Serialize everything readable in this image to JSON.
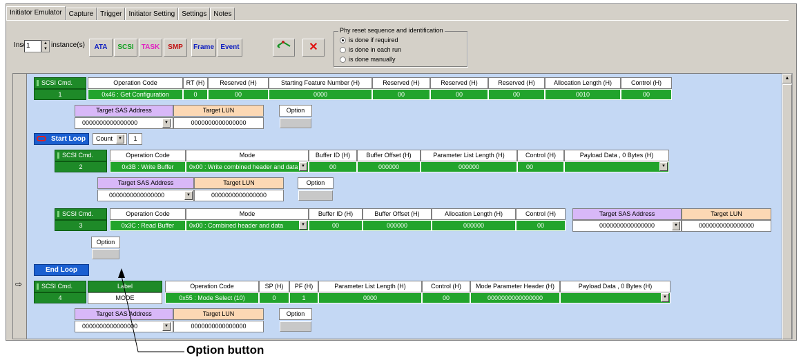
{
  "tabs": [
    "Initiator Emulator",
    "Capture",
    "Trigger",
    "Initiator Setting",
    "Settings",
    "Notes"
  ],
  "toolbar": {
    "insert_label": "Insert",
    "insert_value": "1",
    "instance_label": "instance(s)",
    "buttons": [
      "ATA",
      "SCSI",
      "TASK",
      "SMP",
      "Frame",
      "Event"
    ],
    "delete_glyph": "✕"
  },
  "phy": {
    "title": "Phy reset sequence and identification",
    "options": [
      "is done if required",
      "is done in each run",
      "is done manually"
    ],
    "selected": 0
  },
  "common": {
    "scsi_cmd": "SCSI Cmd.",
    "target_sas": "Target SAS Address",
    "target_lun": "Target LUN",
    "option": "Option",
    "sas_value": "0000000000000000",
    "lun_value": "0000000000000000",
    "opcode": "Operation Code",
    "control": "Control (H)"
  },
  "cmd1": {
    "num": "1",
    "headers": [
      "RT (H)",
      "Reserved (H)",
      "Starting Feature Number (H)",
      "Reserved (H)",
      "Reserved (H)",
      "Reserved (H)",
      "Allocation Length (H)"
    ],
    "opcode_value": "0x46 : Get Configuration",
    "values": [
      "0",
      "00",
      "0000",
      "00",
      "00",
      "00",
      "0010",
      "00"
    ]
  },
  "loop": {
    "start": "Start Loop",
    "count_label": "Count",
    "count_value": "1",
    "end": "End Loop"
  },
  "cmd2": {
    "num": "2",
    "mode_label": "Mode",
    "headers": [
      "Buffer ID (H)",
      "Buffer Offset (H)",
      "Parameter List Length (H)",
      "Payload Data , 0 Bytes (H)"
    ],
    "opcode_value": "0x3B : Write Buffer",
    "mode_value": "0x00 : Write combined header and data",
    "values": [
      "00",
      "000000",
      "000000",
      "00"
    ]
  },
  "cmd3": {
    "num": "3",
    "headers": [
      "Buffer ID (H)",
      "Buffer Offset (H)",
      "Allocation Length (H)"
    ],
    "opcode_value": "0x3C : Read Buffer",
    "mode_value": "0x00 : Combined header and data",
    "values": [
      "00",
      "000000",
      "000000",
      "00"
    ]
  },
  "cmd4": {
    "num": "4",
    "label_header": "Label",
    "label_value": "MODE",
    "headers": [
      "SP (H)",
      "PF (H)",
      "Parameter List Length (H)",
      "Mode Parameter Header (H)",
      "Payload Data , 0 Bytes (H)"
    ],
    "opcode_value": "0x55 : Mode Select (10)",
    "values": [
      "0",
      "1",
      "0000",
      "00",
      "0000000000000000"
    ]
  },
  "annotation": "Option button"
}
